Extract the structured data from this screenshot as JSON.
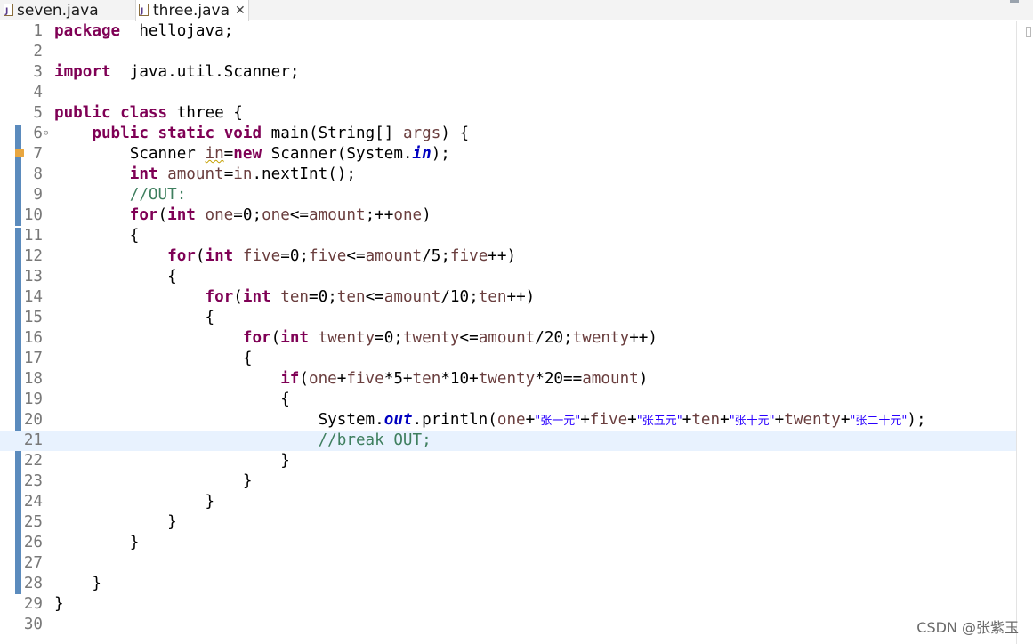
{
  "tabs": [
    {
      "label": "seven.java",
      "active": false,
      "icon": "java-file-icon"
    },
    {
      "label": "three.java",
      "active": true,
      "icon": "java-file-icon",
      "close": "✕"
    }
  ],
  "editor": {
    "current_line": 21,
    "lines": [
      {
        "n": "1",
        "t": [
          [
            "kw",
            "package"
          ],
          [
            "",
            "  hellojava;"
          ]
        ]
      },
      {
        "n": "2",
        "t": []
      },
      {
        "n": "3",
        "t": [
          [
            "kw",
            "import"
          ],
          [
            "",
            "  java.util.Scanner;"
          ]
        ]
      },
      {
        "n": "4",
        "t": []
      },
      {
        "n": "5",
        "t": [
          [
            "kw",
            "public"
          ],
          [
            "",
            " "
          ],
          [
            "kw",
            "class"
          ],
          [
            "",
            " three {"
          ]
        ]
      },
      {
        "n": "6",
        "fold": "⊖",
        "t": [
          [
            "",
            "    "
          ],
          [
            "kw",
            "public"
          ],
          [
            "",
            " "
          ],
          [
            "kw",
            "static"
          ],
          [
            "",
            " "
          ],
          [
            "kw",
            "void"
          ],
          [
            "",
            " main(String[] "
          ],
          [
            "var",
            "args"
          ],
          [
            "",
            ") {"
          ]
        ]
      },
      {
        "n": "7",
        "warn": true,
        "t": [
          [
            "",
            "        Scanner "
          ],
          [
            "var squig",
            "in"
          ],
          [
            "",
            "="
          ],
          [
            "kw",
            "new"
          ],
          [
            "",
            " Scanner(System."
          ],
          [
            "fld",
            "in"
          ],
          [
            "",
            ");"
          ]
        ]
      },
      {
        "n": "8",
        "t": [
          [
            "",
            "        "
          ],
          [
            "kw",
            "int"
          ],
          [
            "",
            " "
          ],
          [
            "var",
            "amount"
          ],
          [
            "",
            "="
          ],
          [
            "var",
            "in"
          ],
          [
            "",
            ".nextInt();"
          ]
        ]
      },
      {
        "n": "9",
        "t": [
          [
            "",
            "        "
          ],
          [
            "cm",
            "//OUT:"
          ]
        ]
      },
      {
        "n": "10",
        "t": [
          [
            "",
            "        "
          ],
          [
            "kw",
            "for"
          ],
          [
            "",
            "("
          ],
          [
            "kw",
            "int"
          ],
          [
            "",
            " "
          ],
          [
            "var",
            "one"
          ],
          [
            "",
            "=0;"
          ],
          [
            "var",
            "one"
          ],
          [
            "",
            "<="
          ],
          [
            "var",
            "amount"
          ],
          [
            "",
            ";++"
          ],
          [
            "var",
            "one"
          ],
          [
            "",
            ")"
          ]
        ]
      },
      {
        "n": "11",
        "t": [
          [
            "",
            "        {"
          ]
        ]
      },
      {
        "n": "12",
        "t": [
          [
            "",
            "            "
          ],
          [
            "kw",
            "for"
          ],
          [
            "",
            "("
          ],
          [
            "kw",
            "int"
          ],
          [
            "",
            " "
          ],
          [
            "var",
            "five"
          ],
          [
            "",
            "=0;"
          ],
          [
            "var",
            "five"
          ],
          [
            "",
            "<="
          ],
          [
            "var",
            "amount"
          ],
          [
            "",
            "/5;"
          ],
          [
            "var",
            "five"
          ],
          [
            "",
            "++)"
          ]
        ]
      },
      {
        "n": "13",
        "t": [
          [
            "",
            "            {"
          ]
        ]
      },
      {
        "n": "14",
        "t": [
          [
            "",
            "                "
          ],
          [
            "kw",
            "for"
          ],
          [
            "",
            "("
          ],
          [
            "kw",
            "int"
          ],
          [
            "",
            " "
          ],
          [
            "var",
            "ten"
          ],
          [
            "",
            "=0;"
          ],
          [
            "var",
            "ten"
          ],
          [
            "",
            "<="
          ],
          [
            "var",
            "amount"
          ],
          [
            "",
            "/10;"
          ],
          [
            "var",
            "ten"
          ],
          [
            "",
            "++)"
          ]
        ]
      },
      {
        "n": "15",
        "t": [
          [
            "",
            "                {"
          ]
        ]
      },
      {
        "n": "16",
        "t": [
          [
            "",
            "                    "
          ],
          [
            "kw",
            "for"
          ],
          [
            "",
            "("
          ],
          [
            "kw",
            "int"
          ],
          [
            "",
            " "
          ],
          [
            "var",
            "twenty"
          ],
          [
            "",
            "=0;"
          ],
          [
            "var",
            "twenty"
          ],
          [
            "",
            "<="
          ],
          [
            "var",
            "amount"
          ],
          [
            "",
            "/20;"
          ],
          [
            "var",
            "twenty"
          ],
          [
            "",
            "++)"
          ]
        ]
      },
      {
        "n": "17",
        "t": [
          [
            "",
            "                    {"
          ]
        ]
      },
      {
        "n": "18",
        "t": [
          [
            "",
            "                        "
          ],
          [
            "kw",
            "if"
          ],
          [
            "",
            "("
          ],
          [
            "var",
            "one"
          ],
          [
            "",
            "+"
          ],
          [
            "var",
            "five"
          ],
          [
            "",
            "*5+"
          ],
          [
            "var",
            "ten"
          ],
          [
            "",
            "*10+"
          ],
          [
            "var",
            "twenty"
          ],
          [
            "",
            "*20=="
          ],
          [
            "var",
            "amount"
          ],
          [
            "",
            ")"
          ]
        ]
      },
      {
        "n": "19",
        "t": [
          [
            "",
            "                        {"
          ]
        ]
      },
      {
        "n": "20",
        "t": [
          [
            "",
            "                            System."
          ],
          [
            "fld",
            "out"
          ],
          [
            "",
            ".println("
          ],
          [
            "var",
            "one"
          ],
          [
            "",
            "+"
          ],
          [
            "st",
            "\"张一元\""
          ],
          [
            "",
            "+"
          ],
          [
            "var",
            "five"
          ],
          [
            "",
            "+"
          ],
          [
            "st",
            "\"张五元\""
          ],
          [
            "",
            "+"
          ],
          [
            "var",
            "ten"
          ],
          [
            "",
            "+"
          ],
          [
            "st",
            "\"张十元\""
          ],
          [
            "",
            "+"
          ],
          [
            "var",
            "twenty"
          ],
          [
            "",
            "+"
          ],
          [
            "st",
            "\"张二十元\""
          ],
          [
            "",
            ");"
          ]
        ]
      },
      {
        "n": "21",
        "t": [
          [
            "",
            "                            "
          ],
          [
            "cm",
            "//break OUT;"
          ]
        ]
      },
      {
        "n": "22",
        "t": [
          [
            "",
            "                        }"
          ]
        ]
      },
      {
        "n": "23",
        "t": [
          [
            "",
            "                    }"
          ]
        ]
      },
      {
        "n": "24",
        "t": [
          [
            "",
            "                }"
          ]
        ]
      },
      {
        "n": "25",
        "t": [
          [
            "",
            "            }"
          ]
        ]
      },
      {
        "n": "26",
        "t": [
          [
            "",
            "        }"
          ]
        ]
      },
      {
        "n": "27",
        "t": []
      },
      {
        "n": "28",
        "t": [
          [
            "",
            "    }"
          ]
        ]
      },
      {
        "n": "29",
        "t": [
          [
            "",
            "}"
          ]
        ]
      },
      {
        "n": "30",
        "t": []
      }
    ]
  },
  "watermark": "CSDN @张紫玉",
  "colors": {
    "keyword": "#7f0055",
    "comment": "#3f7f5f",
    "string": "#2a00ff",
    "field": "#0000c0",
    "variable": "#6a3e3e",
    "current_line": "#e8f2fe",
    "change_bar": "#5b8bbd"
  }
}
